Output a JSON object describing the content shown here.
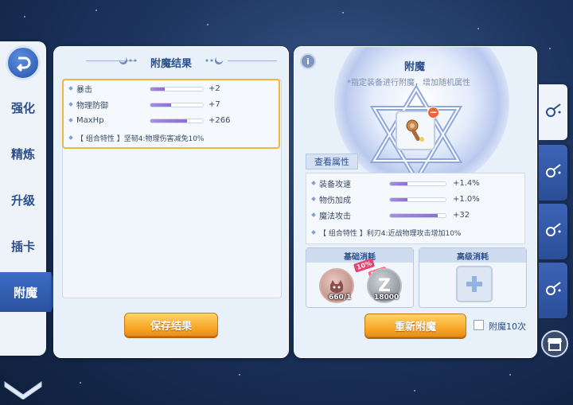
{
  "nav": {
    "items": [
      {
        "label": "强化"
      },
      {
        "label": "精炼"
      },
      {
        "label": "升级"
      },
      {
        "label": "插卡"
      },
      {
        "label": "附魔",
        "active": true
      }
    ]
  },
  "left_panel": {
    "title": "附魔结果",
    "attributes": [
      {
        "name": "暴击",
        "value": "+2",
        "level": 0.28
      },
      {
        "name": "物理防御",
        "value": "+7",
        "level": 0.4
      },
      {
        "name": "MaxHp",
        "value": "+266",
        "level": 0.7
      }
    ],
    "combo": "【 组合特性 】坚韧4:物理伤害减免10%",
    "save_button": "保存结果"
  },
  "right_panel": {
    "title": "附魔",
    "subtitle": "*指定装备进行附魔，增加随机属性",
    "info_icon": "i",
    "view_button": "查看属性",
    "attributes": [
      {
        "name": "装备攻速",
        "value": "+1.4%",
        "level": 0.32
      },
      {
        "name": "物伤加成",
        "value": "+1.0%",
        "level": 0.32
      },
      {
        "name": "魔法攻击",
        "value": "+32",
        "level": 0.85
      }
    ],
    "combo": "【 组合特性 】利刃4:近战物理攻击增加10%",
    "basic_cost": {
      "title": "基础消耗",
      "items": [
        {
          "icon": "enchant-material-icon",
          "count": "660/1"
        },
        {
          "icon": "zeny-coin-icon",
          "count": "18000"
        }
      ],
      "sale_badge": "10%",
      "sale_tag": "SALE"
    },
    "advanced_cost": {
      "title": "高级消耗"
    },
    "reenchant_button": "重新附魔",
    "enchant10_label": "附魔10次"
  },
  "colors": {
    "accent_blue": "#2b4f8a",
    "orange": "#f7a92a",
    "purple_fill": "#8e6fd0",
    "highlight_border": "#f0b640"
  }
}
